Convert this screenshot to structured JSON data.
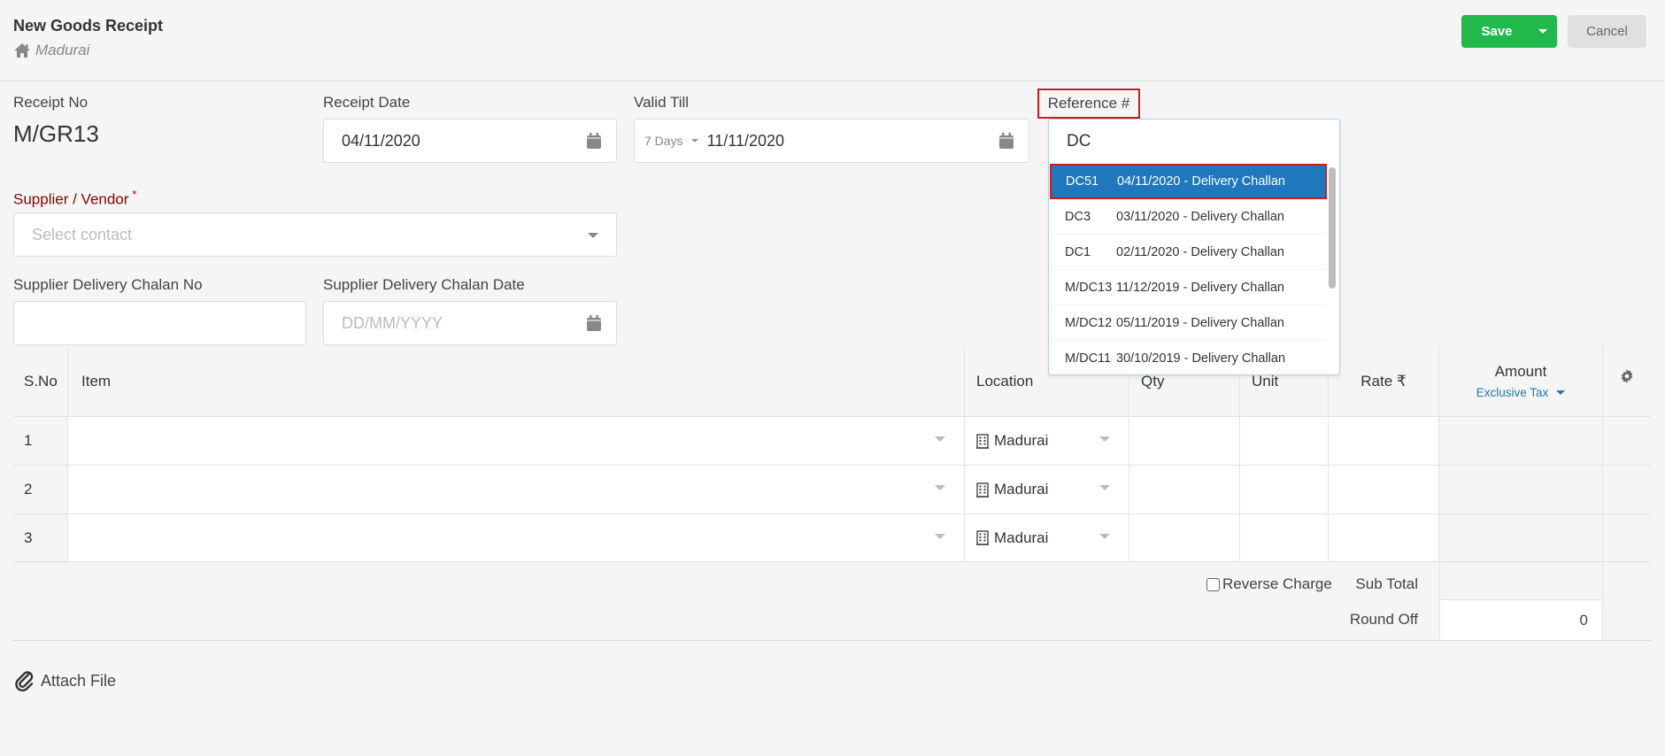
{
  "header": {
    "title": "New Goods Receipt",
    "branch": "Madurai",
    "save_label": "Save",
    "cancel_label": "Cancel"
  },
  "colors": {
    "save": "#22b94c",
    "highlight": "#1f78be",
    "focus_outline": "#d21a1a",
    "required_label": "#8b0000",
    "link": "#1f78be"
  },
  "form": {
    "receipt_no_label": "Receipt No",
    "receipt_no": "M/GR13",
    "receipt_date_label": "Receipt Date",
    "receipt_date": "04/11/2020",
    "valid_till_label": "Valid Till",
    "valid_till_period": "7 Days",
    "valid_till_date": "11/11/2020",
    "reference_label": "Reference #",
    "reference_query": "DC",
    "supplier_label": "Supplier / Vendor",
    "supplier_required_mark": "*",
    "supplier_placeholder": "Select contact",
    "chalan_no_label": "Supplier Delivery Chalan No",
    "chalan_no": "",
    "chalan_date_label": "Supplier Delivery Chalan Date",
    "chalan_date_placeholder": "DD/MM/YYYY"
  },
  "reference_options": [
    {
      "code": "DC51",
      "desc": "04/11/2020 -  Delivery Challan",
      "selected": true
    },
    {
      "code": "DC3",
      "desc": "03/11/2020 -  Delivery Challan"
    },
    {
      "code": "DC1",
      "desc": "02/11/2020 -  Delivery Challan"
    },
    {
      "code": "M/DC13",
      "desc": "11/12/2019 -  Delivery Challan"
    },
    {
      "code": "M/DC12",
      "desc": "05/11/2019 -  Delivery Challan"
    },
    {
      "code": "M/DC11",
      "desc": "30/10/2019 -  Delivery Challan"
    }
  ],
  "table": {
    "headers": {
      "sno": "S.No",
      "item": "Item",
      "location": "Location",
      "qty": "Qty",
      "unit": "Unit",
      "rate": "Rate ₹",
      "amount": "Amount",
      "tax_mode": "Exclusive Tax"
    },
    "rows": [
      {
        "sno": "1",
        "item": "",
        "location": "Madurai",
        "qty": "",
        "unit": "",
        "rate": "",
        "amount": ""
      },
      {
        "sno": "2",
        "item": "",
        "location": "Madurai",
        "qty": "",
        "unit": "",
        "rate": "",
        "amount": ""
      },
      {
        "sno": "3",
        "item": "",
        "location": "Madurai",
        "qty": "",
        "unit": "",
        "rate": "",
        "amount": ""
      }
    ]
  },
  "totals": {
    "reverse_charge_label": "Reverse Charge",
    "reverse_charge_checked": false,
    "sub_total_label": "Sub Total",
    "sub_total": "",
    "round_off_label": "Round Off",
    "round_off": "0"
  },
  "attach_label": "Attach File"
}
